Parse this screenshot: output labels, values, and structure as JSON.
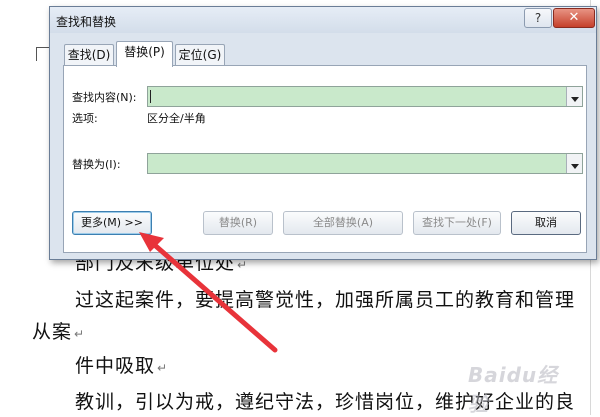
{
  "document": {
    "lines": [
      "部门及末级单位处",
      "过这起案件，要提高警觉性，加强所属员工的教育和管理",
      "从案",
      "件中吸取",
      "教训，引以为戒，遵纪守法，珍惜岗位，维护好企业的良"
    ],
    "paragraph_mark": "↵"
  },
  "dialog": {
    "title": "查找和替换",
    "help_label": "?",
    "close_label": "✕",
    "tabs": [
      {
        "label": "查找(D)",
        "active": false
      },
      {
        "label": "替换(P)",
        "active": true
      },
      {
        "label": "定位(G)",
        "active": false
      }
    ],
    "find_label": "查找内容(N):",
    "find_value": "",
    "options_label": "选项:",
    "options_value": "区分全/半角",
    "replace_label": "替换为(I):",
    "replace_value": "",
    "buttons": {
      "more": "更多(M) >>",
      "replace": "替换(R)",
      "replace_all": "全部替换(A)",
      "find_next": "查找下一处(F)",
      "cancel": "取消"
    }
  },
  "watermark": "Baidu经验",
  "colors": {
    "input_bg": "#c9e9cb",
    "dialog_bg": "#dce4ee",
    "arrow": "#e8333a",
    "close_btn": "#c5402b"
  }
}
